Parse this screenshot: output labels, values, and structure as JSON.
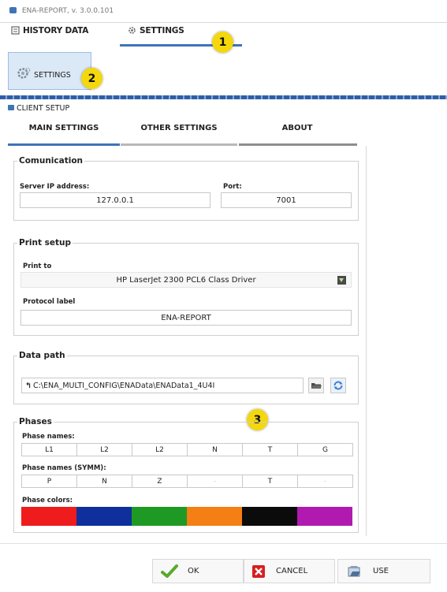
{
  "window": {
    "title": "ENA-REPORT, v. 3.0.0.101"
  },
  "main_tabs": [
    {
      "label": "HISTORY DATA"
    },
    {
      "label": "SETTINGS"
    }
  ],
  "toolbar": {
    "settings_label": "SETTINGS"
  },
  "client_setup": {
    "title": "CLIENT SETUP",
    "tabs": [
      {
        "label": "MAIN SETTINGS"
      },
      {
        "label": "OTHER SETTINGS"
      },
      {
        "label": "ABOUT"
      }
    ]
  },
  "communication": {
    "legend": "Comunication",
    "server_ip_label": "Server IP address:",
    "server_ip_value": "127.0.0.1",
    "port_label": "Port:",
    "port_value": "7001"
  },
  "print_setup": {
    "legend": "Print setup",
    "print_to_label": "Print to",
    "print_to_value": "HP LaserJet 2300 PCL6 Class Driver",
    "protocol_label": "Protocol label",
    "protocol_value": "ENA-REPORT"
  },
  "data_path": {
    "legend": "Data path",
    "value": "C:\\ENA_MULTI_CONFIG\\ENAData\\ENAData1_4U4I"
  },
  "phases": {
    "legend": "Phases",
    "names_label": "Phase names:",
    "names": [
      "L1",
      "L2",
      "L2",
      "N",
      "T",
      "G"
    ],
    "symm_label": "Phase names (SYMM):",
    "symm": [
      "P",
      "N",
      "Z",
      "-",
      "T",
      "-"
    ],
    "colors_label": "Phase colors:",
    "colors": [
      "#ee1c1c",
      "#0f2f9c",
      "#1e9a24",
      "#f47f14",
      "#0b0b0b",
      "#b01ab0"
    ]
  },
  "badges": [
    "1",
    "2",
    "3"
  ],
  "footer": {
    "ok_label": "OK",
    "cancel_label": "CANCEL",
    "use_label": "USE"
  },
  "colors": {
    "accent": "#3f74b8",
    "badge": "#f4d80d"
  }
}
